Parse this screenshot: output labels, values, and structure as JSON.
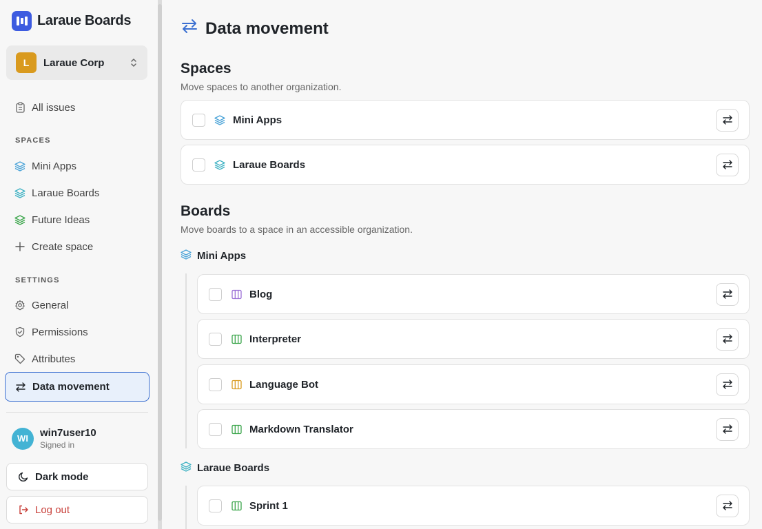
{
  "app": {
    "name": "Laraue Boards"
  },
  "org": {
    "initial": "L",
    "name": "Laraue Corp"
  },
  "nav": {
    "all_issues": "All issues",
    "spaces_label": "SPACES",
    "spaces": [
      "Mini Apps",
      "Laraue Boards",
      "Future Ideas"
    ],
    "create_space": "Create space",
    "settings_label": "SETTINGS",
    "settings": [
      "General",
      "Permissions",
      "Attributes",
      "Data movement"
    ],
    "active": "Data movement"
  },
  "user": {
    "initials": "WI",
    "name": "win7user10",
    "status": "Signed in"
  },
  "actions": {
    "dark_mode": "Dark mode",
    "log_out": "Log out"
  },
  "page": {
    "title": "Data movement",
    "spaces_section": {
      "title": "Spaces",
      "description": "Move spaces to another organization.",
      "items": [
        "Mini Apps",
        "Laraue Boards"
      ]
    },
    "boards_section": {
      "title": "Boards",
      "description": "Move boards to a space in an accessible organization.",
      "groups": [
        {
          "space": "Mini Apps",
          "boards": [
            {
              "name": "Blog",
              "color": "#9b6fd6"
            },
            {
              "name": "Interpreter",
              "color": "#3aa54a"
            },
            {
              "name": "Language Bot",
              "color": "#d99a1e"
            },
            {
              "name": "Markdown Translator",
              "color": "#3aa54a"
            }
          ]
        },
        {
          "space": "Laraue Boards",
          "boards": [
            {
              "name": "Sprint 1",
              "color": "#3aa54a"
            }
          ]
        }
      ]
    }
  },
  "colors": {
    "brand": "#3d5be0",
    "active_border": "#3b6fd1",
    "space_icon_blue": "#4aa3d8",
    "space_icon_teal": "#3fb2c4",
    "space_icon_green": "#3aa54a",
    "danger": "#c8403a"
  }
}
